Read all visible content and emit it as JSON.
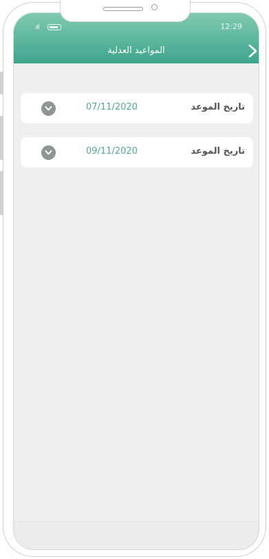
{
  "status_bar": {
    "time": "12:29",
    "signal_icon": "signal-icon",
    "battery_icon": "battery-icon"
  },
  "header": {
    "title": "المواعيد العدلية",
    "back_icon": "chevron-right-icon"
  },
  "appointments": [
    {
      "label": "تاريخ الموعد",
      "date": "07/11/2020",
      "icon": "chevron-down-icon"
    },
    {
      "label": "تاريخ الموعد",
      "date": "09/11/2020",
      "icon": "chevron-down-icon"
    }
  ],
  "colors": {
    "header_top": "#7fcab1",
    "header_bottom": "#3fa58d",
    "date_text": "#56a898",
    "background": "#efefef"
  }
}
